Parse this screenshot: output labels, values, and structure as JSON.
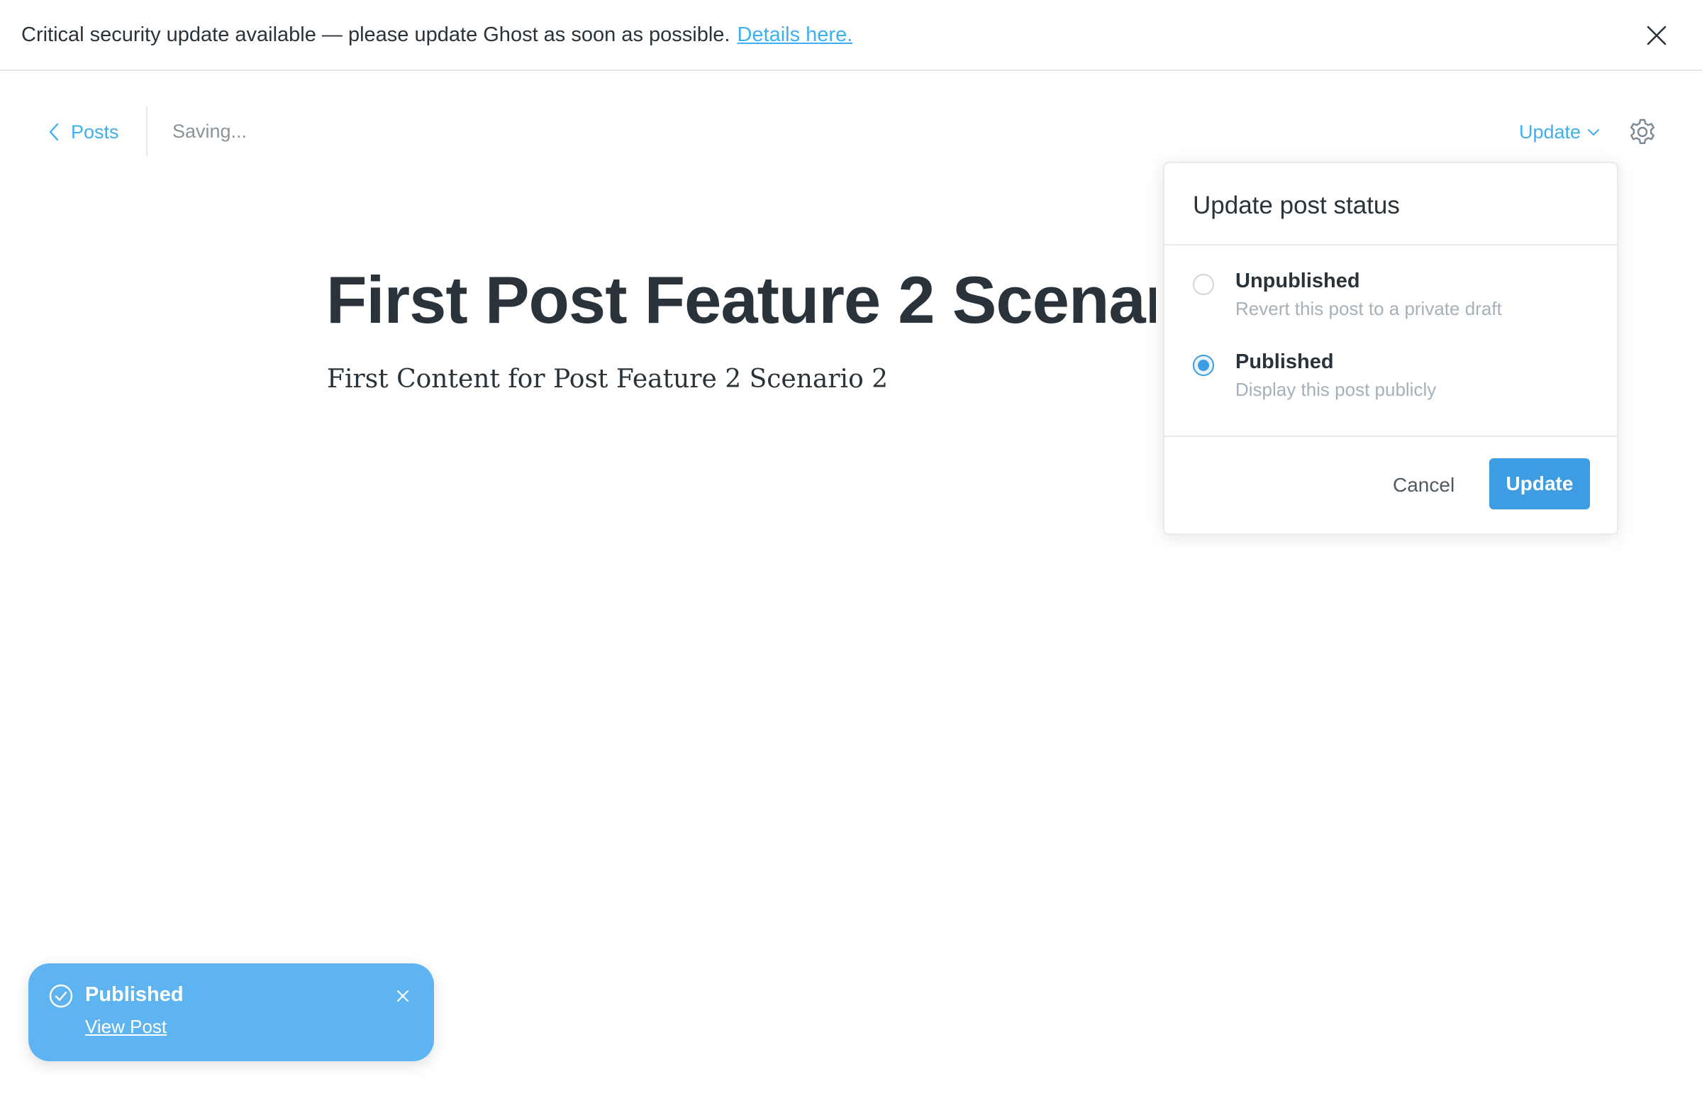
{
  "banner": {
    "message": "Critical security update available — please update Ghost as soon as possible.",
    "link_text": "Details here."
  },
  "header": {
    "back_label": "Posts",
    "saving_text": "Saving...",
    "update_trigger_label": "Update"
  },
  "post": {
    "title": "First Post Feature 2 Scenario 2",
    "body": "First Content for Post Feature 2 Scenario 2"
  },
  "status_popover": {
    "title": "Update post status",
    "options": [
      {
        "label": "Unpublished",
        "description": "Revert this post to a private draft",
        "selected": false
      },
      {
        "label": "Published",
        "description": "Display this post publicly",
        "selected": true
      }
    ],
    "cancel_label": "Cancel",
    "update_label": "Update"
  },
  "toast": {
    "title": "Published",
    "link_text": "View Post"
  },
  "colors": {
    "accent": "#3eb0ef",
    "primary_button": "#3e9de2",
    "toast_bg": "#5eb4f0",
    "text": "#2a333a",
    "muted": "#a6b0b8"
  },
  "icons": [
    "close-icon",
    "chevron-left-icon",
    "chevron-down-icon",
    "gear-icon",
    "check-circle-icon"
  ]
}
